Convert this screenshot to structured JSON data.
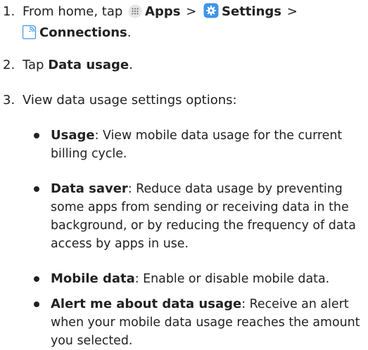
{
  "steps": [
    {
      "number": "1.",
      "prefix": "From home, tap",
      "apps_label": "Apps",
      "separator": ">",
      "settings_label": "Settings",
      "connections_label": "Connections",
      "end": "."
    },
    {
      "number": "2.",
      "prefix": "Tap",
      "label": "Data usage",
      "end": "."
    },
    {
      "number": "3.",
      "text": "View data usage settings options:"
    }
  ],
  "options": [
    {
      "label": "Usage",
      "description": ": View mobile data usage for the current billing cycle."
    },
    {
      "label": "Data saver",
      "description": ": Reduce data usage by preventing some apps from sending or receiving data in the background, or by reducing the frequency of data access by apps in use."
    },
    {
      "label": "Mobile data",
      "description": ": Enable or disable mobile data."
    },
    {
      "label": "Alert me about data usage",
      "description": ": Receive an alert when your mobile data usage reaches the amount you selected."
    }
  ],
  "icons": {
    "apps": "apps-grid-icon",
    "settings": "settings-gear-icon",
    "connections": "connections-icon",
    "accent_color": "#3e95e8"
  }
}
